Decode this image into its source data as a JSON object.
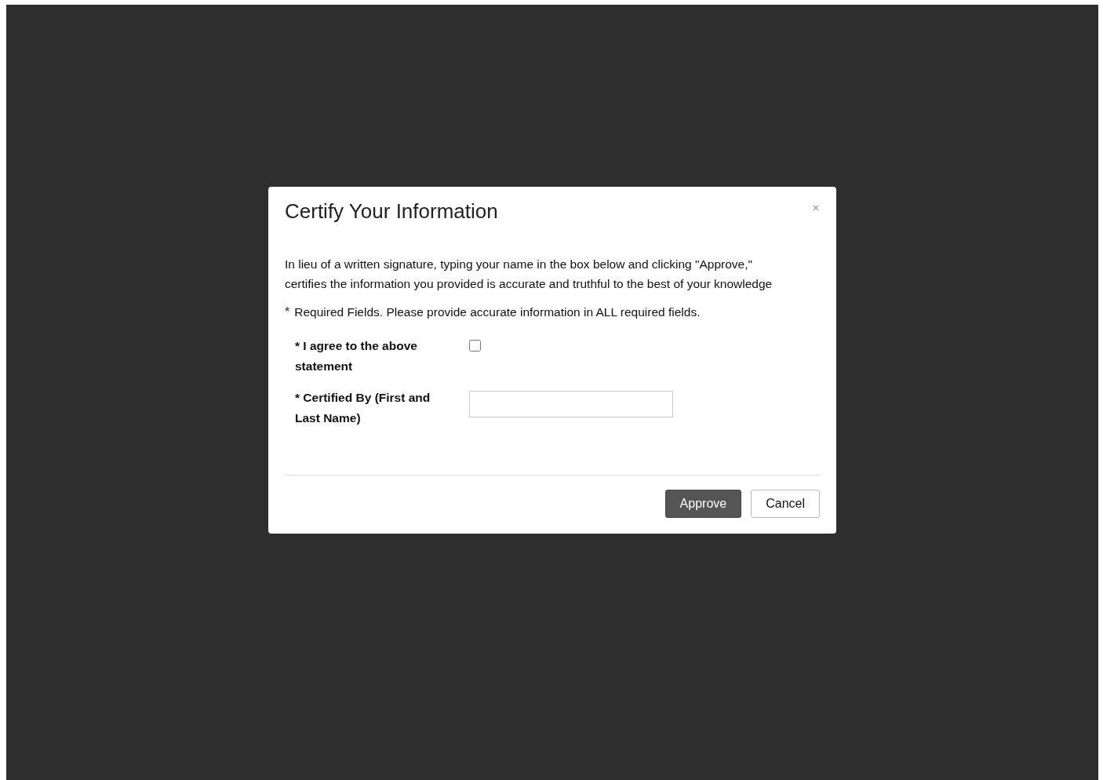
{
  "dialog": {
    "title": "Certify Your Information",
    "statement": "In lieu of a written signature, typing your name in the box below and clicking \"Approve,\" certifies the information you provided is accurate and truthful to the best of your knowledge",
    "required_note": {
      "mark": "*",
      "text": "Required Fields. Please provide accurate information in ALL required fields."
    },
    "fields": [
      {
        "kind": "checkbox",
        "mark": "*",
        "label": "I agree to the above statement",
        "checked": false
      },
      {
        "kind": "text",
        "mark": "*",
        "label": "Certified By (First and Last Name)"
      }
    ],
    "buttons": [
      {
        "label": "Approve",
        "primary": true
      },
      {
        "label": "Cancel",
        "primary": false
      }
    ]
  }
}
